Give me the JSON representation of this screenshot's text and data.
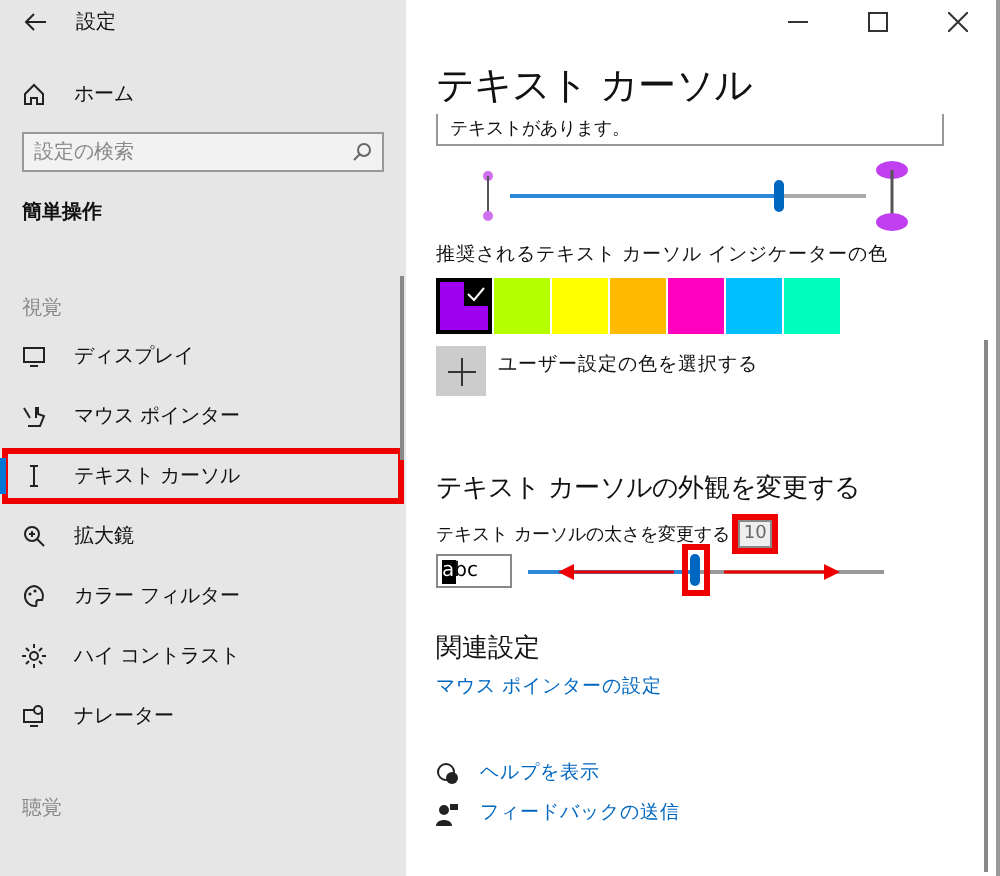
{
  "window": {
    "title": "設定"
  },
  "sidebar": {
    "home": "ホーム",
    "search": {
      "placeholder": "設定の検索"
    },
    "section": "簡単操作",
    "groups": [
      {
        "heading": "視覚",
        "items": [
          {
            "label": "ディスプレイ",
            "selected": false,
            "highlighted": false
          },
          {
            "label": "マウス ポインター",
            "selected": false,
            "highlighted": false
          },
          {
            "label": "テキスト カーソル",
            "selected": true,
            "highlighted": true
          },
          {
            "label": "拡大鏡",
            "selected": false,
            "highlighted": false
          },
          {
            "label": "カラー フィルター",
            "selected": false,
            "highlighted": false
          },
          {
            "label": "ハイ コントラスト",
            "selected": false,
            "highlighted": false
          },
          {
            "label": "ナレーター",
            "selected": false,
            "highlighted": false
          }
        ]
      },
      {
        "heading": "聴覚"
      }
    ]
  },
  "content": {
    "title": "テキスト カーソル",
    "preview_text": "テキストがあります。",
    "indicator_size": {
      "level": 0.75
    },
    "colors_label": "推奨されるテキスト カーソル インジケーターの色",
    "colors": [
      {
        "color": "#a000f0",
        "selected": true
      },
      {
        "color": "#b4ff00",
        "selected": false
      },
      {
        "color": "#ffff00",
        "selected": false
      },
      {
        "color": "#ffb900",
        "selected": false
      },
      {
        "color": "#ff00bf",
        "selected": false
      },
      {
        "color": "#00bfff",
        "selected": false
      },
      {
        "color": "#00ffbf",
        "selected": false
      }
    ],
    "custom_color": "ユーザー設定の色を選択する",
    "appearance": {
      "heading": "テキスト カーソルの外観を変更する",
      "thickness_label": "テキスト カーソルの太さを変更する",
      "thickness_value": "10",
      "preview": "abc",
      "level": 0.47,
      "highlighted": true
    },
    "related": {
      "heading": "関連設定",
      "links": [
        "マウス ポインターの設定"
      ]
    },
    "help": [
      "ヘルプを表示",
      "フィードバックの送信"
    ]
  }
}
